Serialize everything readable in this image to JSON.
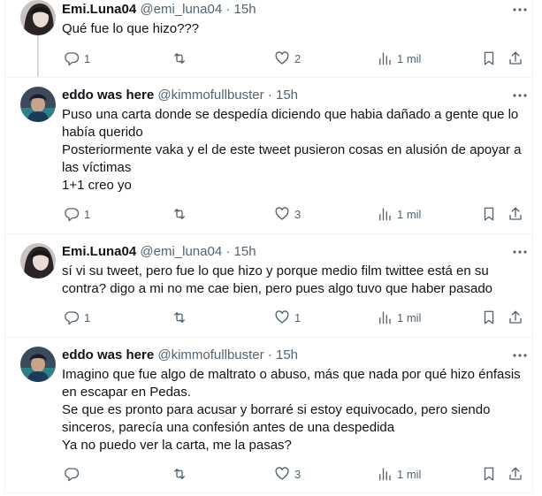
{
  "replies": [
    {
      "name": "Emi.Luna04",
      "handle": "@emi_luna04",
      "dot": "·",
      "time": "15h",
      "text": [
        "Qué fue lo que hizo???"
      ],
      "reply_count": "1",
      "retweet_count": "",
      "like_count": "2",
      "view_count": "1 mil"
    },
    {
      "name": "eddo was here",
      "handle": "@kimmofullbuster",
      "dot": "·",
      "time": "15h",
      "text": [
        "Puso una carta donde se despedía diciendo que habia dañado a gente que lo había querido",
        "Posteriormente vaka y el de este tweet pusieron cosas en alusión de apoyar a las víctimas",
        "1+1 creo yo"
      ],
      "reply_count": "1",
      "retweet_count": "",
      "like_count": "3",
      "view_count": "1 mil"
    },
    {
      "name": "Emi.Luna04",
      "handle": "@emi_luna04",
      "dot": "·",
      "time": "15h",
      "text": [
        "sí vi su tweet, pero fue lo que hizo y porque medio film twittee está en su contra? digo a mi no me cae bien, pero pues algo tuvo que haber pasado"
      ],
      "reply_count": "1",
      "retweet_count": "",
      "like_count": "1",
      "view_count": "1 mil"
    },
    {
      "name": "eddo was here",
      "handle": "@kimmofullbuster",
      "dot": "·",
      "time": "15h",
      "text": [
        "Imagino que fue algo de maltrato o abuso, más que nada por qué hizo énfasis en escapar en Pedas.",
        "Se que es pronto para acusar y borraré si estoy equivocado, pero siendo sinceros, parecía una confesión antes de una despedida",
        "Ya no puedo ver la carta, me la pasas?"
      ],
      "reply_count": "",
      "retweet_count": "",
      "like_count": "3",
      "view_count": "1 mil"
    }
  ],
  "colors": {
    "text": "#0f1419",
    "muted": "#536471",
    "divider": "#eff3f4",
    "thread_line": "#cfd9de"
  }
}
